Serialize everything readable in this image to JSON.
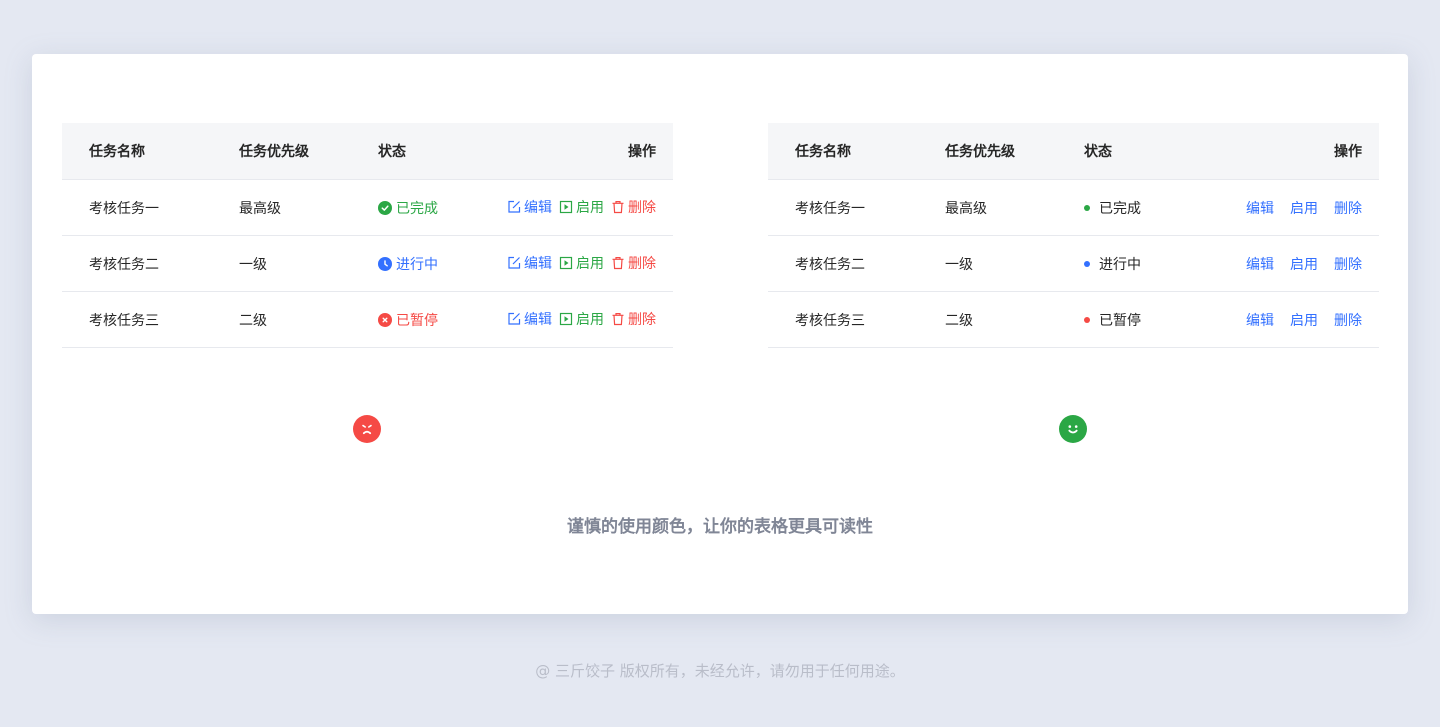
{
  "left_table": {
    "headers": {
      "name": "任务名称",
      "priority": "任务优先级",
      "status": "状态",
      "actions": "操作"
    },
    "rows": [
      {
        "name": "考核任务一",
        "priority": "最高级",
        "status": "已完成",
        "status_kind": "done",
        "icon": "check-circle-icon"
      },
      {
        "name": "考核任务二",
        "priority": "一级",
        "status": "进行中",
        "status_kind": "in-progress",
        "icon": "clock-icon"
      },
      {
        "name": "考核任务三",
        "priority": "二级",
        "status": "已暂停",
        "status_kind": "paused",
        "icon": "close-circle-icon"
      }
    ],
    "actions": {
      "edit": "编辑",
      "enable": "启用",
      "delete": "删除"
    }
  },
  "right_table": {
    "headers": {
      "name": "任务名称",
      "priority": "任务优先级",
      "status": "状态",
      "actions": "操作"
    },
    "rows": [
      {
        "name": "考核任务一",
        "priority": "最高级",
        "status": "已完成",
        "status_kind": "done"
      },
      {
        "name": "考核任务二",
        "priority": "一级",
        "status": "进行中",
        "status_kind": "in-progress"
      },
      {
        "name": "考核任务三",
        "priority": "二级",
        "status": "已暂停",
        "status_kind": "paused"
      }
    ],
    "actions": {
      "edit": "编辑",
      "enable": "启用",
      "delete": "删除"
    }
  },
  "indicators": {
    "bad": "sad-face-icon",
    "good": "happy-face-icon"
  },
  "caption": "谨慎的使用颜色，让你的表格更具可读性",
  "footer": "@ 三斤饺子  版权所有，未经允许，请勿用于任何用途。",
  "colors": {
    "done": "#2ba745",
    "in_progress": "#3370ff",
    "paused": "#f54a45",
    "link": "#3370ff"
  }
}
